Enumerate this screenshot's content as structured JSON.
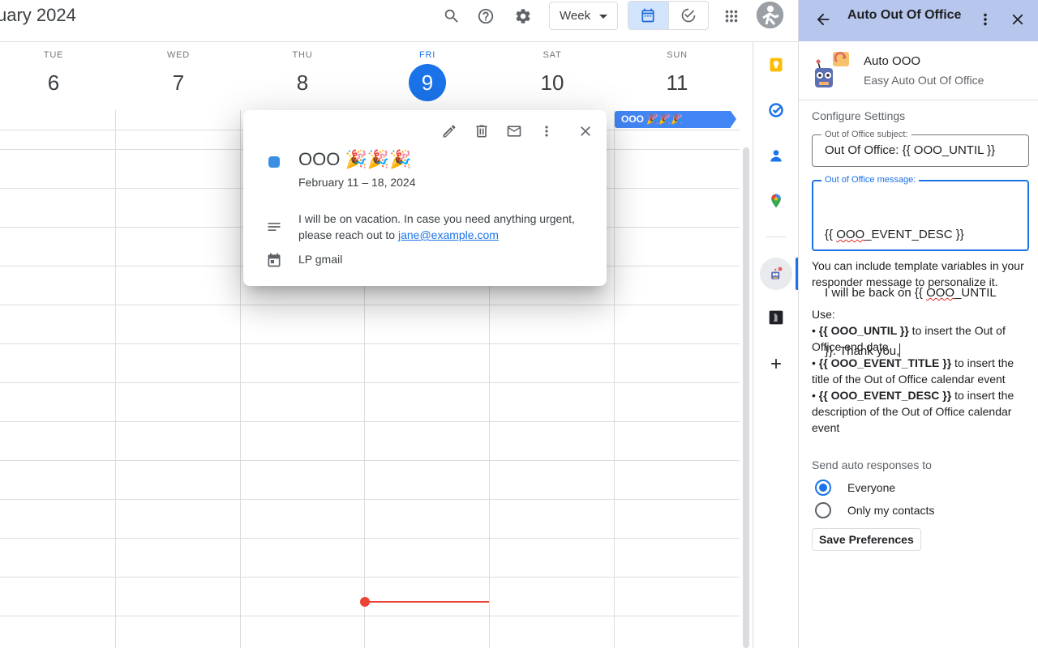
{
  "header": {
    "month_title": "uary 2024",
    "view_select": "Week",
    "icons": [
      "search-icon",
      "help-icon",
      "settings-icon",
      "calendar-icon",
      "tasks-icon",
      "apps-grid-icon",
      "avatar"
    ]
  },
  "days": [
    {
      "name": "TUE",
      "num": "6"
    },
    {
      "name": "WED",
      "num": "7"
    },
    {
      "name": "THU",
      "num": "8"
    },
    {
      "name": "FRI",
      "num": "9",
      "today": true
    },
    {
      "name": "SAT",
      "num": "10"
    },
    {
      "name": "SUN",
      "num": "11"
    }
  ],
  "allday_event": {
    "label": "OOO 🎉🎉🎉"
  },
  "popup": {
    "title": "OOO 🎉🎉🎉",
    "dates": "February 11 – 18, 2024",
    "description": "I will be on vacation. In case you need anything urgent, please reach out to ",
    "description_link": "jane@example.com",
    "calendar": "LP gmail",
    "color": "#3a8fe3"
  },
  "panel": {
    "title": "Auto Out Of Office",
    "addon_name": "Auto OOO",
    "addon_subtitle": "Easy Auto Out Of Office",
    "configure_heading": "Configure Settings",
    "subject_label": "Out of Office subject:",
    "subject_value": "Out Of Office: {{ OOO_UNTIL }}",
    "message_label": "Out of Office message:",
    "message_line1": "{{ OOO_EVENT_DESC }}",
    "message_line2": "I will be back on {{ OOO_UNTIL",
    "message_line3": "}}. Thank you,",
    "help_text": "You can include template variables in your responder message to personalize it.",
    "use_label": "Use:",
    "help_items": [
      {
        "var": "{{ OOO_UNTIL }}",
        "text": " to insert the Out of Office end date"
      },
      {
        "var": "{{ OOO_EVENT_TITLE }}",
        "text": " to insert the title of the Out of Office calendar event"
      },
      {
        "var": "{{ OOO_EVENT_DESC }}",
        "text": " to insert the description of the Out of Office calendar event"
      }
    ],
    "send_heading": "Send auto responses to",
    "radio_options": [
      {
        "label": "Everyone",
        "selected": true
      },
      {
        "label": "Only my contacts",
        "selected": false
      }
    ],
    "save_label": "Save Preferences"
  },
  "colors": {
    "accent": "#1a73e8",
    "panel_header": "#b7c6ec",
    "event": "#4285f4",
    "now_line": "#ea4335"
  }
}
